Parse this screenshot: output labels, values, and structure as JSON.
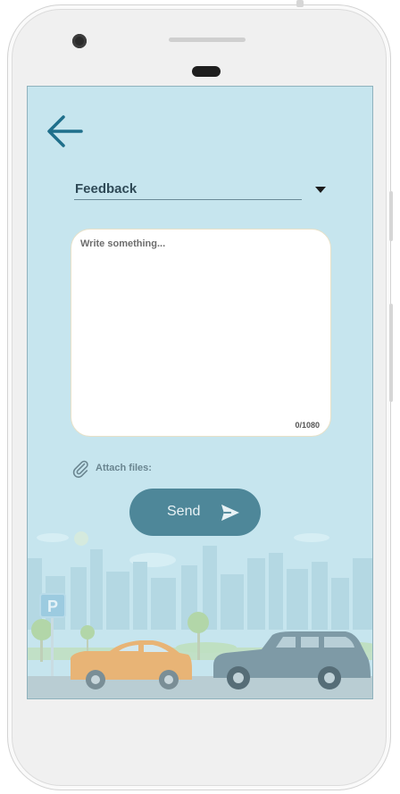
{
  "header": {
    "back_icon": "arrow-left-icon"
  },
  "form": {
    "category_selected": "Feedback",
    "message_placeholder": "Write something...",
    "message_value": "",
    "char_counter": "0/1080",
    "attach_label": "Attach files:",
    "attach_icon": "paperclip-icon",
    "send_label": "Send",
    "send_icon": "paper-plane-icon"
  },
  "illustration": {
    "sign_letter": "P"
  },
  "colors": {
    "screen_bg": "#c6e5ee",
    "accent": "#1f6f8b",
    "send_button": "#4e8799",
    "car_orange": "#e8b476",
    "suv_gray": "#7e9aa6"
  }
}
